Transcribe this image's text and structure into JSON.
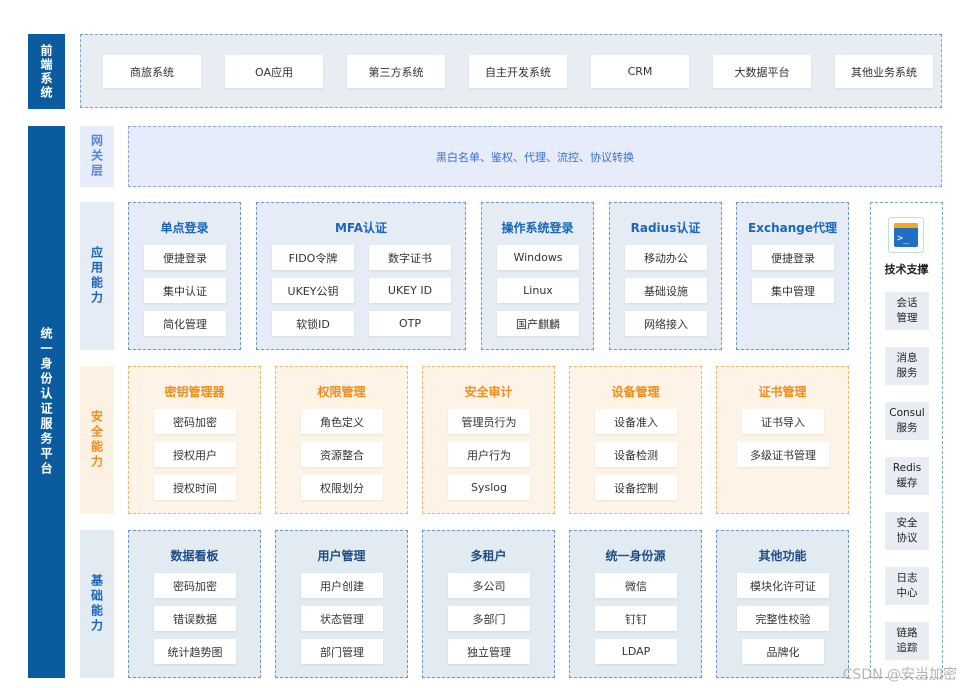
{
  "frontend": {
    "label": "前端系统",
    "systems": [
      "商旅系统",
      "OA应用",
      "第三方系统",
      "自主开发系统",
      "CRM",
      "大数据平台",
      "其他业务系统"
    ]
  },
  "platform": {
    "label": "统一身份认证服务平台"
  },
  "gateway": {
    "label": "网关层",
    "text": "黑白名单、鉴权、代理、流控、协议转换"
  },
  "app": {
    "label": "应用能力",
    "cards": [
      {
        "title": "单点登录",
        "items": [
          "便捷登录",
          "集中认证",
          "简化管理"
        ]
      },
      {
        "title": "MFA认证",
        "items": [
          "FIDO令牌",
          "数字证书",
          "UKEY公钥",
          "UKEY ID",
          "软锁ID",
          "OTP"
        ]
      },
      {
        "title": "操作系统登录",
        "items": [
          "Windows",
          "Linux",
          "国产麒麟"
        ]
      },
      {
        "title": "Radius认证",
        "items": [
          "移动办公",
          "基础设施",
          "网络接入"
        ]
      },
      {
        "title": "Exchange代理",
        "items": [
          "便捷登录",
          "集中管理"
        ]
      }
    ]
  },
  "security": {
    "label": "安全能力",
    "cards": [
      {
        "title": "密钥管理器",
        "items": [
          "密码加密",
          "授权用户",
          "授权时间"
        ]
      },
      {
        "title": "权限管理",
        "items": [
          "角色定义",
          "资源整合",
          "权限划分"
        ]
      },
      {
        "title": "安全审计",
        "items": [
          "管理员行为",
          "用户行为",
          "Syslog"
        ]
      },
      {
        "title": "设备管理",
        "items": [
          "设备准入",
          "设备检测",
          "设备控制"
        ]
      },
      {
        "title": "证书管理",
        "items": [
          "证书导入",
          "多级证书管理"
        ]
      }
    ]
  },
  "base": {
    "label": "基础能力",
    "cards": [
      {
        "title": "数据看板",
        "items": [
          "密码加密",
          "错误数据",
          "统计趋势图"
        ]
      },
      {
        "title": "用户管理",
        "items": [
          "用户创建",
          "状态管理",
          "部门管理"
        ]
      },
      {
        "title": "多租户",
        "items": [
          "多公司",
          "多部门",
          "独立管理"
        ]
      },
      {
        "title": "统一身份源",
        "items": [
          "微信",
          "钉钉",
          "LDAP"
        ]
      },
      {
        "title": "其他功能",
        "items": [
          "模块化许可证",
          "完整性校验",
          "品牌化"
        ]
      }
    ]
  },
  "tech": {
    "title": "技术支撑",
    "icon_glyph": ">_",
    "icon": "terminal-icon",
    "items": [
      [
        "会话",
        "管理"
      ],
      [
        "消息",
        "服务"
      ],
      [
        "Consul",
        "服务"
      ],
      [
        "Redis",
        "缓存"
      ],
      [
        "安全",
        "协议"
      ],
      [
        "日志",
        "中心"
      ],
      [
        "链路",
        "追踪"
      ]
    ]
  },
  "watermark": "CSDN @安当加密",
  "colors": {
    "brand": "#0b5c9e",
    "accent_blue": "#1a66b8",
    "accent_orange": "#f08d1c"
  }
}
